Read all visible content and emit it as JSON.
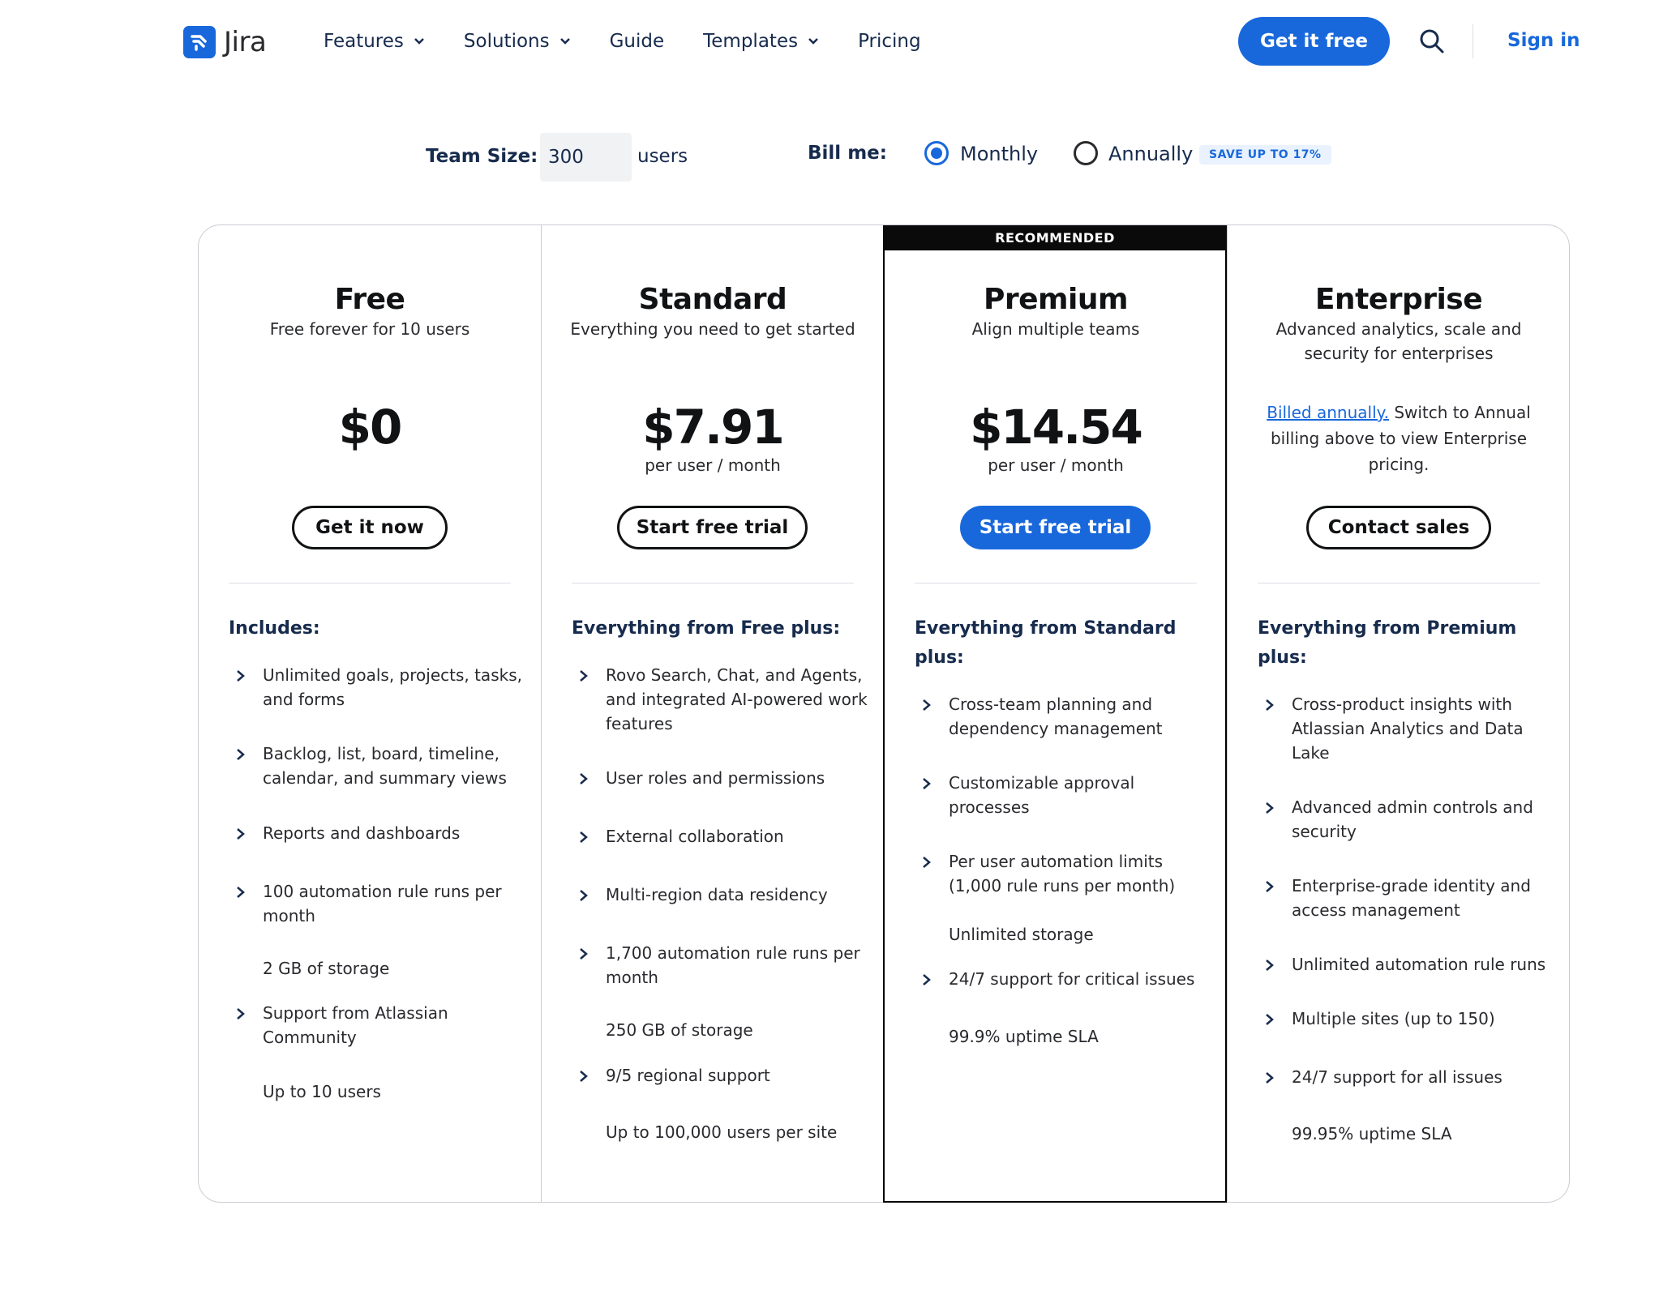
{
  "nav": {
    "logo_text": "Jira",
    "links": [
      {
        "label": "Features",
        "dropdown": true
      },
      {
        "label": "Solutions",
        "dropdown": true
      },
      {
        "label": "Guide",
        "dropdown": false
      },
      {
        "label": "Templates",
        "dropdown": true
      },
      {
        "label": "Pricing",
        "dropdown": false
      }
    ],
    "cta_label": "Get it free",
    "search_icon": "search-icon",
    "signin_label": "Sign in"
  },
  "controls": {
    "team_size_label": "Team Size:",
    "team_size_value": "300",
    "users_label": "users",
    "bill_label": "Bill me:",
    "monthly_label": "Monthly",
    "annually_label": "Annually",
    "selected_billing": "Monthly",
    "save_badge": "SAVE UP TO 17%"
  },
  "colors": {
    "accent": "#1868db",
    "text": "#172b4d",
    "border": "#c9ccd2",
    "recommended_bg": "#0a0a0a"
  },
  "plans": [
    {
      "name": "Free",
      "subtitle": "Free forever for 10 users",
      "price": "$0",
      "price_unit": "",
      "cta": "Get it now",
      "includes_title": "Includes:",
      "features": [
        {
          "text": "Unlimited goals, projects, tasks, and forms",
          "chevron": true
        },
        {
          "text": "Backlog, list, board, timeline, calendar, and summary views",
          "chevron": true
        },
        {
          "text": "Reports and dashboards",
          "chevron": true
        },
        {
          "text": "100 automation rule runs per month",
          "chevron": true
        },
        {
          "text": "2 GB of storage",
          "chevron": false
        },
        {
          "text": "Support from Atlassian Community",
          "chevron": true
        },
        {
          "text": "Up to 10 users",
          "chevron": false
        }
      ]
    },
    {
      "name": "Standard",
      "subtitle": "Everything you need to get started",
      "price": "$7.91",
      "price_unit": "per user / month",
      "cta": "Start free trial",
      "includes_title": "Everything from Free plus:",
      "features": [
        {
          "text": "Rovo Search, Chat, and Agents, and integrated AI-powered work features",
          "chevron": true
        },
        {
          "text": "User roles and permissions",
          "chevron": true
        },
        {
          "text": "External collaboration",
          "chevron": true
        },
        {
          "text": "Multi-region data residency",
          "chevron": true
        },
        {
          "text": "1,700 automation rule runs per month",
          "chevron": true
        },
        {
          "text": "250 GB of storage",
          "chevron": false
        },
        {
          "text": "9/5 regional support",
          "chevron": true
        },
        {
          "text": "Up to 100,000 users per site",
          "chevron": false
        }
      ]
    },
    {
      "name": "Premium",
      "recommended": "RECOMMENDED",
      "subtitle": "Align multiple teams",
      "price": "$14.54",
      "price_unit": "per user / month",
      "cta": "Start free trial",
      "includes_title": "Everything from Standard plus:",
      "features": [
        {
          "text": "Cross-team planning and dependency management",
          "chevron": true
        },
        {
          "text": "Customizable approval processes",
          "chevron": true
        },
        {
          "text": "Per user automation limits (1,000 rule runs per month)",
          "chevron": true
        },
        {
          "text": "Unlimited storage",
          "chevron": false
        },
        {
          "text": "24/7 support for critical issues",
          "chevron": true
        },
        {
          "text": "99.9% uptime SLA",
          "chevron": false
        }
      ]
    },
    {
      "name": "Enterprise",
      "subtitle": "Advanced analytics, scale and security for enterprises",
      "note_link": "Billed annually.",
      "note_text": " Switch to Annual billing above to view Enterprise pricing.",
      "cta": "Contact sales",
      "includes_title": "Everything from Premium plus:",
      "features": [
        {
          "text": "Cross-product insights with Atlassian Analytics and Data Lake",
          "chevron": true
        },
        {
          "text": "Advanced admin controls and security",
          "chevron": true
        },
        {
          "text": "Enterprise-grade identity and access management",
          "chevron": true
        },
        {
          "text": "Unlimited automation rule runs",
          "chevron": true
        },
        {
          "text": "Multiple sites (up to 150)",
          "chevron": true
        },
        {
          "text": "24/7 support for all issues",
          "chevron": true
        },
        {
          "text": "99.95% uptime SLA",
          "chevron": false
        }
      ]
    }
  ]
}
